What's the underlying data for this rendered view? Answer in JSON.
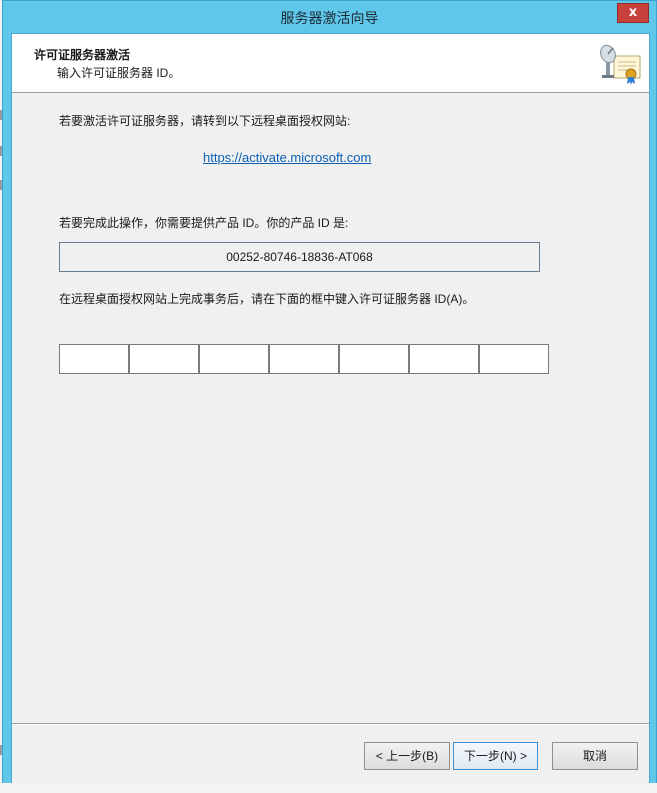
{
  "window": {
    "title": "服务器激活向导",
    "close_glyph": "x"
  },
  "header": {
    "title": "许可证服务器激活",
    "subtitle": "输入许可证服务器 ID。",
    "icon": "certificate-satellite-icon"
  },
  "body": {
    "intro_text": "若要激活许可证服务器，请转到以下远程桌面授权网站:",
    "activation_url": "https://activate.microsoft.com",
    "product_id_prompt": "若要完成此操作，你需要提供产品 ID。你的产品 ID 是:",
    "product_id": "00252-80746-18836-AT068",
    "license_id_prompt": "在远程桌面授权网站上完成事务后，请在下面的框中键入许可证服务器 ID(A)。",
    "license_id_fields": [
      "",
      "",
      "",
      "",
      "",
      "",
      ""
    ]
  },
  "buttons": {
    "back_label": "< 上一步(B)",
    "next_label": "下一步(N) >",
    "cancel_label": "取消"
  },
  "colors": {
    "title_bar": "#5fc7ea",
    "close_button": "#c8413a",
    "link": "#0b5fb5",
    "client_background": "#f0f0f0"
  }
}
